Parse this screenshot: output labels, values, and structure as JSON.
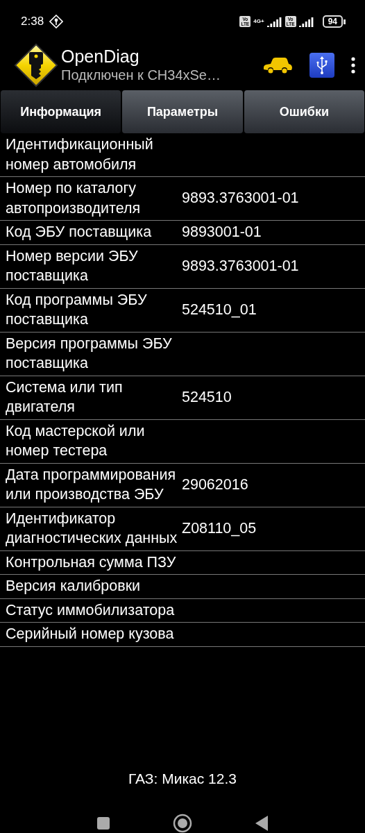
{
  "status_bar": {
    "time": "2:38",
    "volte_badges": [
      "Vo LTE",
      "Vo LTE"
    ],
    "network": "4G+",
    "battery": "94"
  },
  "app_bar": {
    "title": "OpenDiag",
    "subtitle": "Подключен к CH34xSe…"
  },
  "tabs": [
    {
      "label": "Информация",
      "selected": true
    },
    {
      "label": "Параметры",
      "selected": false
    },
    {
      "label": "Ошибки",
      "selected": false
    }
  ],
  "rows": [
    {
      "name": "Идентификационный номер автомобиля"
    },
    {
      "name": "Номер по каталогу автопроизводителя",
      "value": "9893.3763001-01"
    },
    {
      "name": "Код ЭБУ поставщика",
      "value": "9893001-01"
    },
    {
      "name": "Номер версии ЭБУ поставщика",
      "value": "9893.3763001-01"
    },
    {
      "name": "Код программы ЭБУ поставщика",
      "value": "524510_01"
    },
    {
      "name": "Версия программы ЭБУ поставщика"
    },
    {
      "name": "Система или тип двигателя",
      "value": "524510"
    },
    {
      "name": "Код мастерской или номер тестера"
    },
    {
      "name": "Дата программирования или производства ЭБУ",
      "value": "29062016"
    },
    {
      "name": "Идентификатор диагностических данных",
      "value": "Z08110_05"
    },
    {
      "name": "Контрольная сумма ПЗУ"
    },
    {
      "name": "Версия калибровки"
    },
    {
      "name": "Статус иммобилизатора"
    },
    {
      "name": "Серийный номер кузова"
    }
  ],
  "footer": "ГАЗ: Микас 12.3"
}
